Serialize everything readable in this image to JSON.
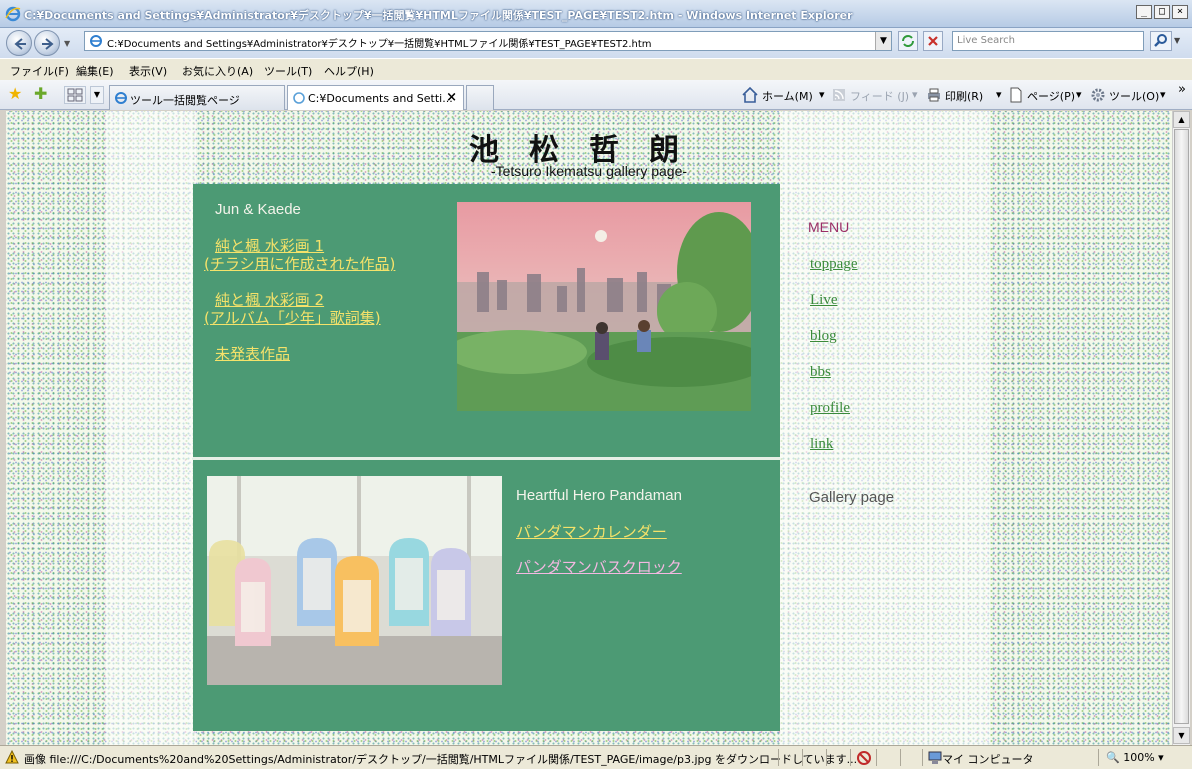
{
  "window": {
    "title": "C:¥Documents and Settings¥Administrator¥デスクトップ¥一括閲覧¥HTMLファイル関係¥TEST_PAGE¥TEST2.htm - Windows Internet Explorer",
    "controls": {
      "minimize": "_",
      "maximize": "□",
      "close": "×"
    }
  },
  "address": {
    "url": "C:¥Documents and Settings¥Administrator¥デスクトップ¥一括閲覧¥HTMLファイル関係¥TEST_PAGE¥TEST2.htm",
    "search_placeholder": "Live Search"
  },
  "menu": [
    "ファイル(F)",
    "編集(E)",
    "表示(V)",
    "お気に入り(A)",
    "ツール(T)",
    "ヘルプ(H)"
  ],
  "tabs": [
    {
      "label": "ツール一括閲覧ページ",
      "active": false
    },
    {
      "label": "C:¥Documents and Setti...",
      "active": true,
      "close": "×"
    }
  ],
  "commands": {
    "home": "ホーム(M)",
    "feeds": "フィード (J)",
    "print": "印刷(R)",
    "page": "ページ(P)",
    "tools": "ツール(O)",
    "more": "»"
  },
  "page": {
    "title": "池松哲朗",
    "subtitle": "-Tetsuro Ikematsu gallery page-",
    "section1": {
      "heading": "Jun & Kaede",
      "links": [
        {
          "line1": "純と楓 水彩画 1",
          "line2": "(チラシ用に作成された作品)"
        },
        {
          "line1": "純と楓 水彩画 2",
          "line2": "(アルバム「少年」歌詞集)"
        },
        {
          "line1": "未発表作品",
          "line2": ""
        }
      ]
    },
    "section2": {
      "heading": "Heartful Hero Pandaman",
      "links": [
        "パンダマンカレンダー",
        "パンダマンバスクロック"
      ]
    },
    "sidemenu": {
      "heading": "MENU",
      "items": [
        "toppage",
        "Live",
        "blog",
        "bbs",
        "profile",
        "link"
      ],
      "current": "Gallery page"
    }
  },
  "status": {
    "text": "画像 file:///C:/Documents%20and%20Settings/Administrator/デスクトップ/一括閲覧/HTMLファイル関係/TEST_PAGE/image/p3.jpg をダウンロードしています...",
    "zone": "マイ コンピュータ",
    "zoom": "100%"
  },
  "colors": {
    "panel": "#4c9a74",
    "link_yellow": "#f5e26a",
    "link_pink": "#f4b8e2",
    "menu_head": "#9a2d66",
    "menu_link": "#3a8a3a"
  }
}
